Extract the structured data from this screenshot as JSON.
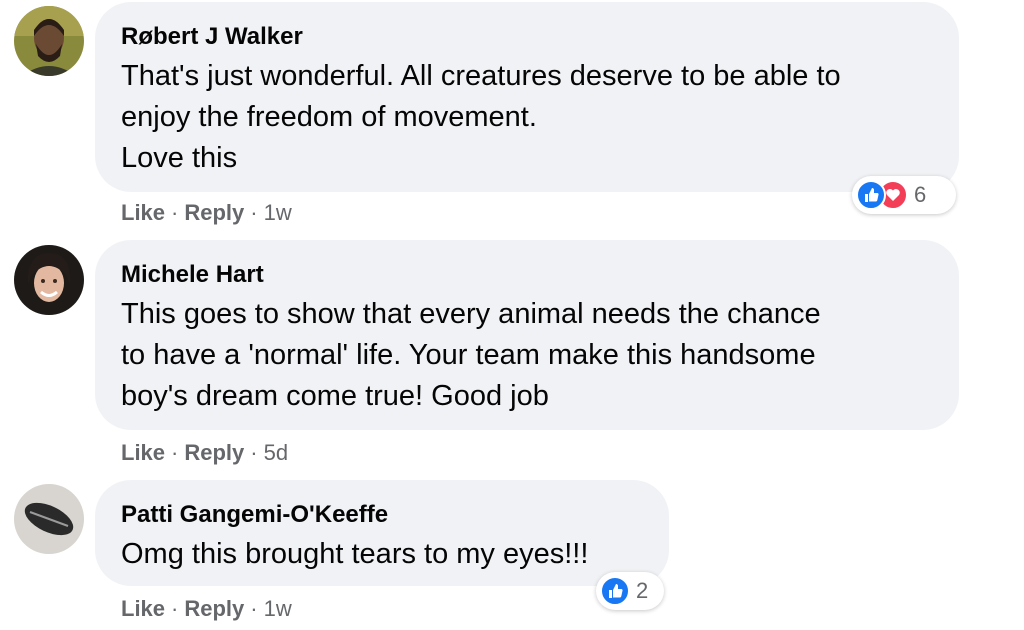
{
  "comments": [
    {
      "author": "Røbert J Walker",
      "lines": [
        "That's just wonderful. All creatures deserve to be able to",
        "enjoy the freedom of movement.",
        "Love this"
      ],
      "actions": {
        "like": "Like",
        "reply": "Reply",
        "sep": "·",
        "time": "1w"
      },
      "reactions": {
        "icons": [
          "like-icon",
          "love-icon"
        ],
        "count": "6"
      }
    },
    {
      "author": "Michele Hart",
      "lines": [
        "This goes to show that every animal needs the chance",
        "to have a 'normal' life. Your team make this handsome",
        "boy's dream come true! Good job"
      ],
      "actions": {
        "like": "Like",
        "reply": "Reply",
        "sep": "·",
        "time": "5d"
      }
    },
    {
      "author": "Patti Gangemi-O'Keeffe",
      "lines": [
        "Omg this brought tears to my eyes!!!"
      ],
      "actions": {
        "like": "Like",
        "reply": "Reply",
        "sep": "·",
        "time": "1w"
      },
      "reactions": {
        "icons": [
          "like-icon"
        ],
        "count": "2"
      }
    }
  ],
  "colors": {
    "like": "#1877f2",
    "love": "#f33e58",
    "bubble": "#f0f2f5",
    "meta": "#65676b"
  }
}
